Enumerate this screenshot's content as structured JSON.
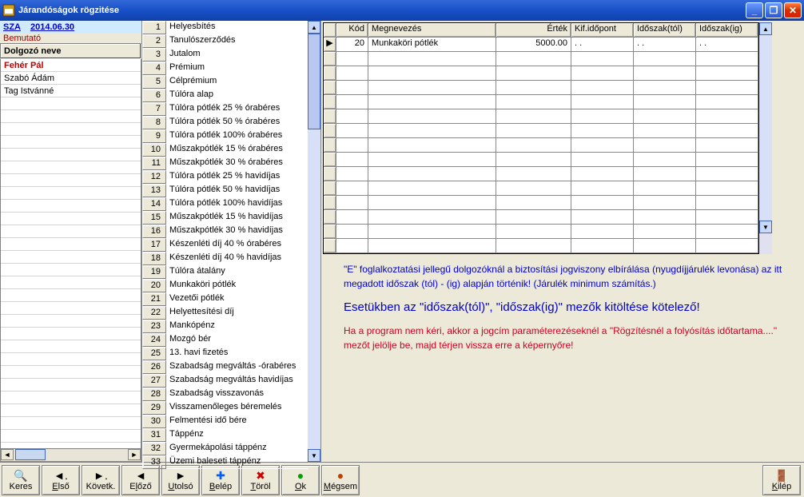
{
  "window": {
    "title": "Járandóságok rögzitése"
  },
  "header": {
    "code": "SZA",
    "date": "2014.06.30",
    "subtitle": "Bemutató"
  },
  "emp_header": "Dolgozó neve",
  "employees": [
    "Fehér Pál",
    "Szabó Ádám",
    "Tag Istvánné"
  ],
  "types": [
    "Helyesbítés",
    "Tanulószerződés",
    "Jutalom",
    "Prémium",
    "Célprémium",
    "Túlóra alap",
    "Túlóra pótlék 25 % órabéres",
    "Túlóra pótlék 50 % órabéres",
    "Túlóra pótlék 100% órabéres",
    "Műszakpótlék 15 % órabéres",
    "Műszakpótlék 30 % órabéres",
    "Túlóra pótlék 25 % havidíjas",
    "Túlóra pótlék 50 % havidíjas",
    "Túlóra pótlék 100% havidíjas",
    "Műszakpótlék 15 % havidíjas",
    "Műszakpótlék 30 % havidíjas",
    "Készenléti díj 40 % órabéres",
    "Készenléti díj 40 % havidíjas",
    "Túlóra átalány",
    "Munkaköri pótlék",
    "Vezetői pótlék",
    "Helyettesítési díj",
    "Mankópénz",
    "Mozgó bér",
    "13. havi fizetés",
    "Szabadság megváltás -órabéres",
    "Szabadság megváltás havidíjas",
    "Szabadság visszavonás",
    "Visszamenőleges béremelés",
    "Felmentési idő bére",
    "Táppénz",
    "Gyermekápolási táppénz",
    "Üzemi baleseti táppénz"
  ],
  "grid": {
    "cols": [
      "",
      "Kód",
      "Megnevezés",
      "Érték",
      "Kif.időpont",
      "Időszak(tól)",
      "Időszak(ig)"
    ],
    "rows": [
      {
        "ind": "▶",
        "kod": "20",
        "meg": "Munkaköri pótlék",
        "ert": "5000.00",
        "kif": " .  .",
        "tol": " .  .",
        "ig": " .  ."
      }
    ],
    "empty_rows": 14
  },
  "info": {
    "l1": "\"E\" foglalkoztatási jellegű dolgozóknál a biztosítási jogviszony elbírálása (nyugdíjjárulék levonása) az itt megadott időszak (tól) - (ig) alapján történik! (Járulék minimum számítás.)",
    "l2": "Esetükben az \"időszak(tól)\", \"időszak(ig)\" mezők kitöltése kötelező!",
    "l3": "Ha a program nem kéri, akkor a jogcím paraméterezéseknél a \"Rögzítésnél a folyósítás időtartama....\" mezőt jelölje be, majd térjen vissza erre a képernyőre!"
  },
  "toolbar": {
    "keres": "Keres",
    "elso": "Első",
    "kovetk": "Követk.",
    "elozo": "Előző",
    "utolso": "Utolsó",
    "belep": "Belép",
    "torol": "Töröl",
    "ok": "Ok",
    "megsem": "Mégsem",
    "kilep": "Kilép"
  },
  "icons": {
    "keres": "🔍",
    "elso": "◄.",
    "kovetk": "►.",
    "elozo": "◄",
    "utolso": "►",
    "belep": "➕",
    "torol": "✖",
    "ok": "●",
    "megsem": "●",
    "kilep": "🚪"
  }
}
